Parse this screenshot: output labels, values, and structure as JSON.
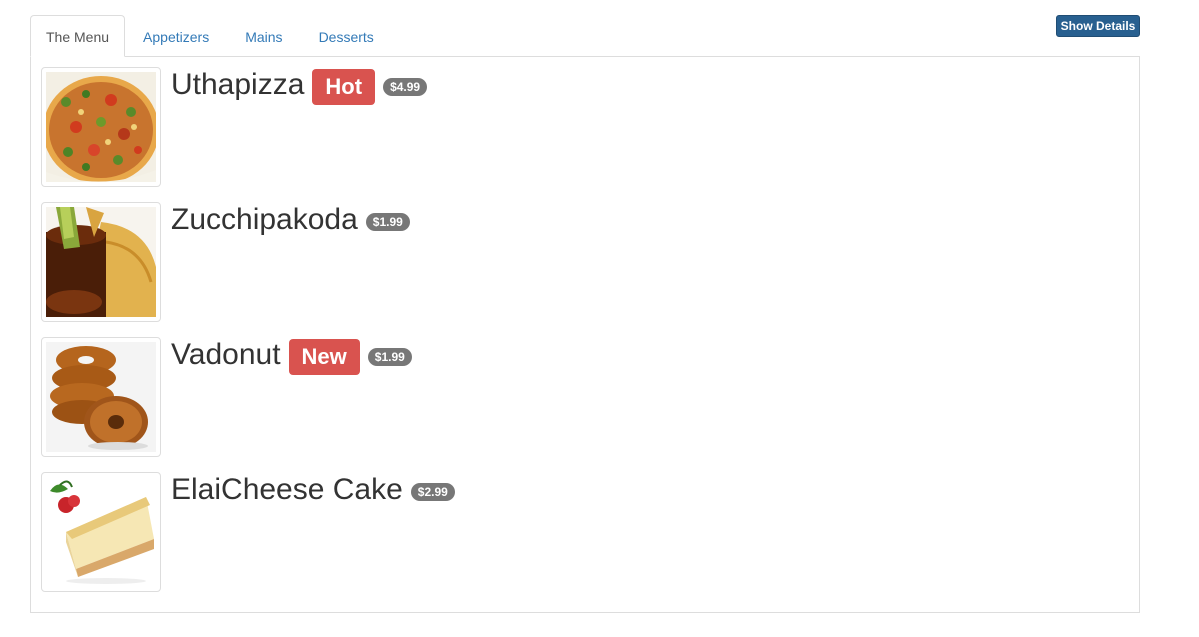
{
  "tabs": [
    {
      "label": "The Menu",
      "active": true
    },
    {
      "label": "Appetizers",
      "active": false
    },
    {
      "label": "Mains",
      "active": false
    },
    {
      "label": "Desserts",
      "active": false
    }
  ],
  "toolbar": {
    "show_details_label": "Show Details"
  },
  "colors": {
    "link": "#337ab7",
    "primary_button": "#286090",
    "label_danger": "#d9534f",
    "badge": "#777777"
  },
  "menu": {
    "items": [
      {
        "name": "Uthapizza",
        "label": "Hot",
        "price": "$4.99",
        "image": "uthapizza-photo"
      },
      {
        "name": "Zucchipakoda",
        "label": "",
        "price": "$1.99",
        "image": "zucchipakoda-photo"
      },
      {
        "name": "Vadonut",
        "label": "New",
        "price": "$1.99",
        "image": "vadonut-photo"
      },
      {
        "name": "ElaiCheese Cake",
        "label": "",
        "price": "$2.99",
        "image": "elaicheese-cake-photo"
      }
    ]
  }
}
